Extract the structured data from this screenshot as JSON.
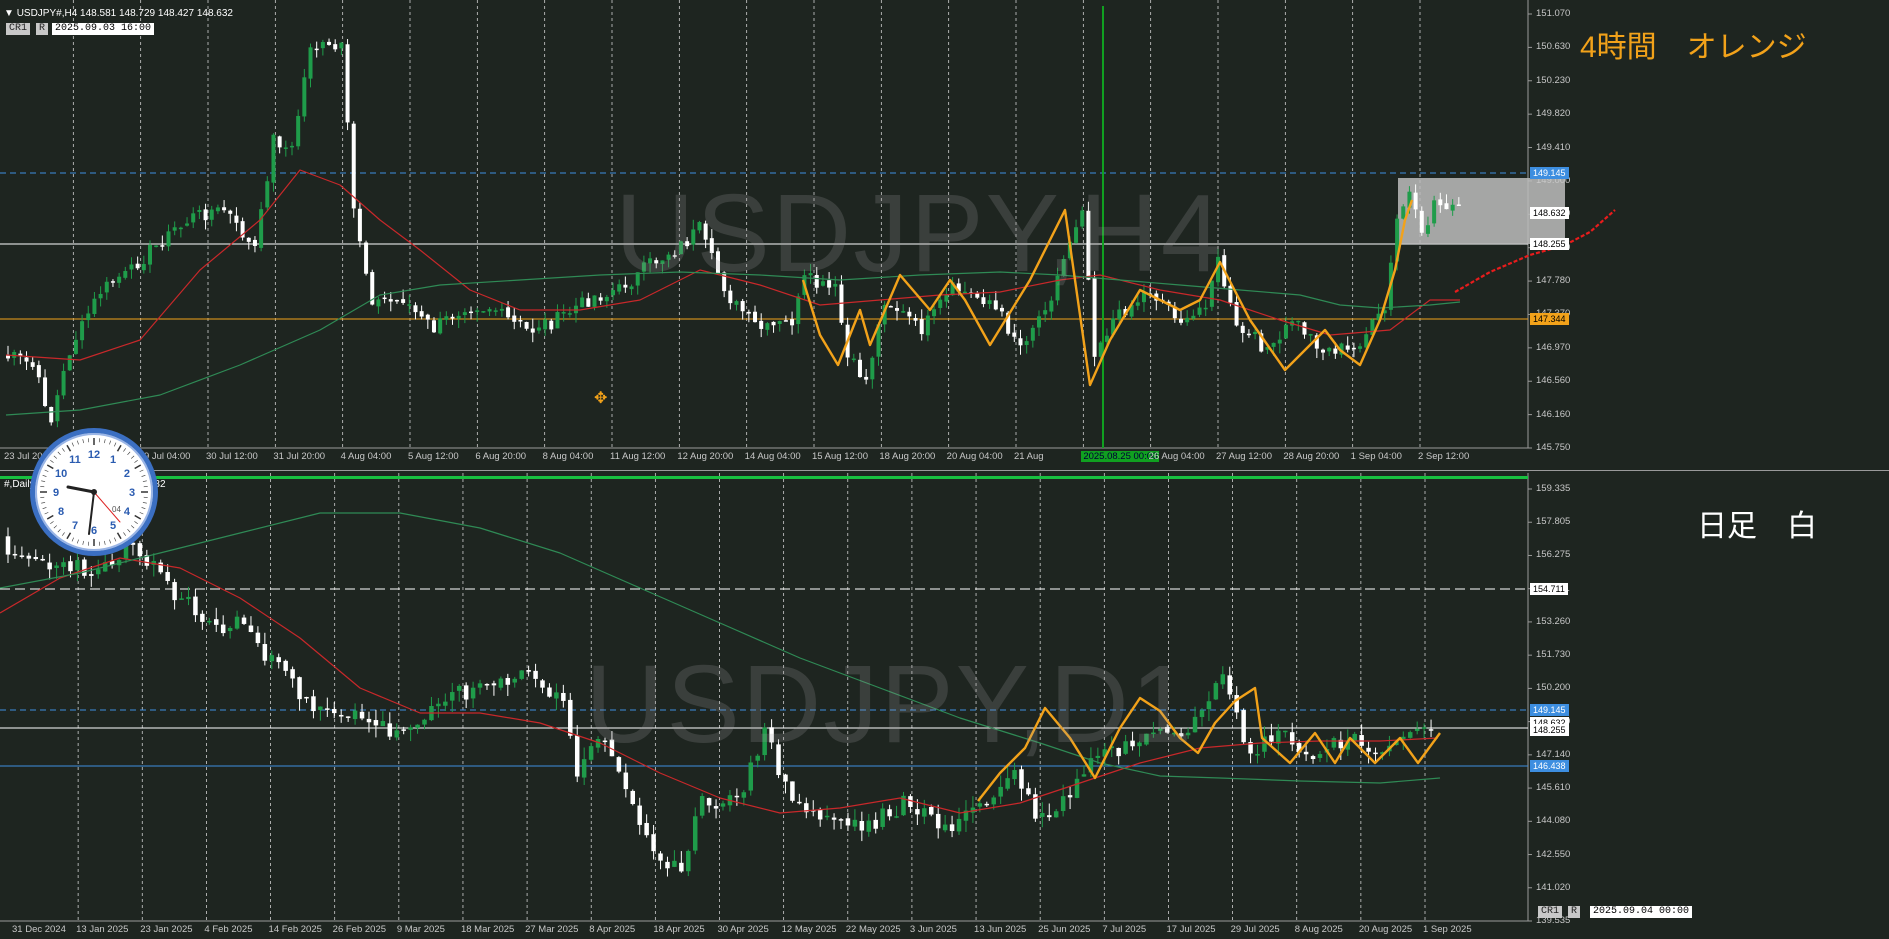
{
  "h4": {
    "title": "USDJPY#,H4  148.581 148.729 148.427 148.632",
    "cr_label": "CR1",
    "r_label": "R",
    "datetime": "2025.09.03 16:00",
    "watermark": "USDJPY,H4",
    "annotation": "4時間　オレンジ",
    "annotation_color": "#f2a21a",
    "price_ticks": [
      "151.070",
      "150.630",
      "150.230",
      "149.820",
      "149.410",
      "149.000",
      "148.590",
      "148.180",
      "147.780",
      "147.370",
      "146.970",
      "146.560",
      "146.160",
      "145.750"
    ],
    "price_tags": [
      {
        "label": "149.145",
        "kind": "blue"
      },
      {
        "label": "148.632",
        "kind": "white"
      },
      {
        "label": "148.255",
        "kind": "white"
      },
      {
        "label": "147.344",
        "kind": "orange"
      }
    ],
    "time_labels": [
      "23 Jul 2025",
      "25 Jul 20:00",
      "29 Jul 04:00",
      "30 Jul 12:00",
      "31 Jul 20:00",
      "4 Aug 04:00",
      "5 Aug 12:00",
      "6 Aug 20:00",
      "8 Aug 04:00",
      "11 Aug 12:00",
      "12 Aug 20:00",
      "14 Aug 04:00",
      "15 Aug 12:00",
      "18 Aug 20:00",
      "20 Aug 04:00",
      "21 Aug",
      "2025.08.25 00:00",
      "26 Aug 04:00",
      "27 Aug 12:00",
      "28 Aug 20:00",
      "1 Sep 04:00",
      "2 Sep 12:00"
    ]
  },
  "d1": {
    "title": "#,Daily",
    "close": "148.632",
    "cr_label": "CR1",
    "r_label": "R",
    "datetime": "2025.09.04 00:00",
    "watermark": "USDJPY,D1",
    "annotation": "日足　白",
    "annotation_color": "#ffffff",
    "price_ticks": [
      "159.335",
      "157.805",
      "156.275",
      "154.711",
      "153.260",
      "151.730",
      "150.200",
      "148.670",
      "147.140",
      "145.610",
      "144.080",
      "142.550",
      "141.020",
      "139.535"
    ],
    "price_tags": [
      {
        "label": "154.711",
        "kind": "white"
      },
      {
        "label": "149.145",
        "kind": "blue"
      },
      {
        "label": "148.632",
        "kind": "white"
      },
      {
        "label": "148.255",
        "kind": "white"
      },
      {
        "label": "146.438",
        "kind": "blue"
      }
    ],
    "time_labels": [
      "31 Dec 2024",
      "13 Jan 2025",
      "23 Jan 2025",
      "4 Feb 2025",
      "14 Feb 2025",
      "26 Feb 2025",
      "9 Mar 2025",
      "18 Mar 2025",
      "27 Mar 2025",
      "8 Apr 2025",
      "18 Apr 2025",
      "30 Apr 2025",
      "12 May 2025",
      "22 May 2025",
      "3 Jun 2025",
      "13 Jun 2025",
      "25 Jun 2025",
      "7 Jul 2025",
      "17 Jul 2025",
      "29 Jul 2025",
      "8 Aug 2025",
      "20 Aug 2025",
      "1 Sep 2025"
    ]
  },
  "clock": {
    "numbers": [
      "12",
      "1",
      "2",
      "3",
      "4",
      "5",
      "6",
      "7",
      "8",
      "9",
      "10",
      "11"
    ],
    "day_label": "04"
  },
  "colors": {
    "background": "#1e2520",
    "bull_candle": "#1f9c4a",
    "bear_candle": "#ffffff",
    "zigzag": "#f2a21a",
    "ma_red": "#c8282a",
    "ma_green": "#2f8a55",
    "level_blue": "#3d8ee0",
    "level_orange": "#f2a21a",
    "vertical_marker": "#10a020"
  }
}
